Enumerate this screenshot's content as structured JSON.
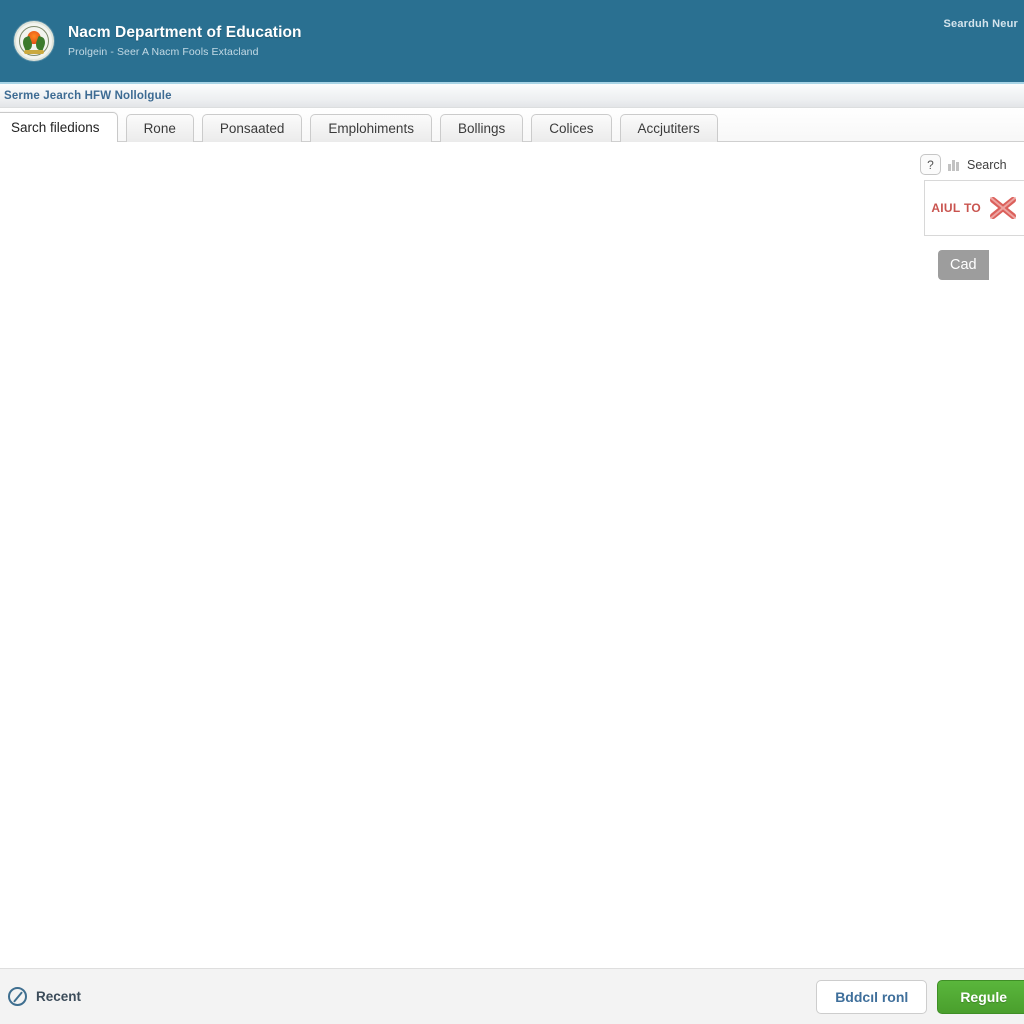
{
  "header": {
    "seal_icon": "government-seal-icon",
    "title": "Nacm Department of Education",
    "subtitle": "Prolgein - Seer A Nacm Fools Extacland",
    "right_link": "Searduh Neur"
  },
  "breadcrumb": {
    "text": "Serme Jearch HFW Nollolgule"
  },
  "tabs": [
    {
      "label": "Sarch filedions",
      "active": true
    },
    {
      "label": "Rone",
      "active": false
    },
    {
      "label": "Ponsaated",
      "active": false
    },
    {
      "label": "Emplohiments",
      "active": false
    },
    {
      "label": "Bollings",
      "active": false
    },
    {
      "label": "Colices",
      "active": false
    },
    {
      "label": "Accjutiters",
      "active": false
    }
  ],
  "side_panel": {
    "help_badge": "?",
    "bars_icon": "bar-chart-icon",
    "head_label": "Search",
    "card_label": "AIUL TO",
    "cross_icon": "red-cross-icon",
    "button_label": "Cad"
  },
  "footer": {
    "recent_icon": "clock-icon",
    "recent_label": "Recent",
    "secondary_button": "Bddcıl ronl",
    "primary_button": "Regule"
  },
  "colors": {
    "header_bg": "#2a7091",
    "accent_line": "#a8d4e6",
    "breadcrumb_link": "#3d6b93",
    "primary_button": "#4a9f2d",
    "card_label": "#c9544f",
    "panel_button": "#9d9d9d"
  }
}
